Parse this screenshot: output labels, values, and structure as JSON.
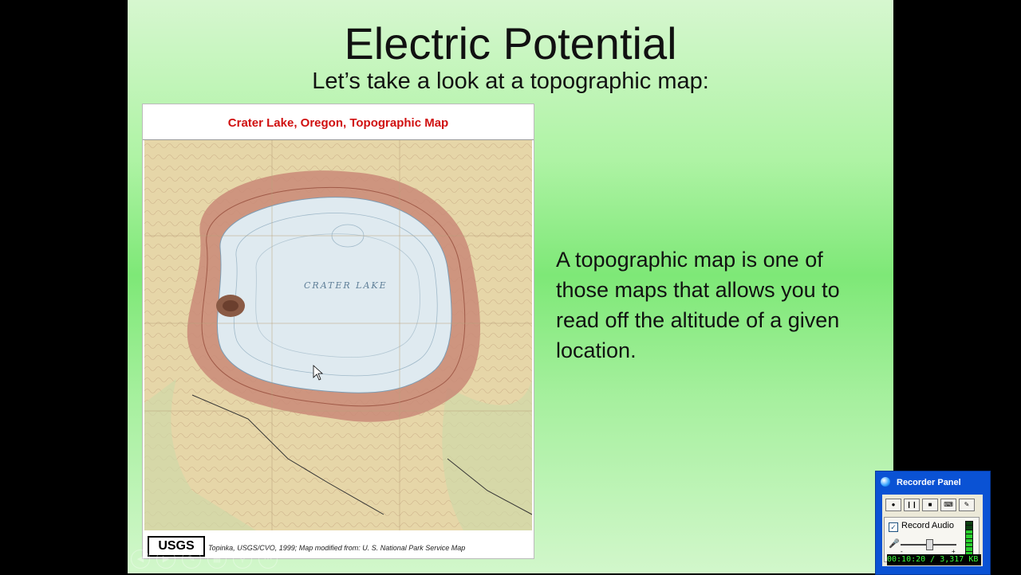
{
  "slide": {
    "title": "Electric Potential",
    "subtitle": "Let’s take a look at a topographic map:",
    "body": "A topographic map is one of those maps that allows you to read off the altitude of a given location."
  },
  "map": {
    "title": "Crater Lake, Oregon, Topographic Map",
    "lake_label": "CRATER LAKE",
    "logo": "USGS",
    "credit": "Topinka, USGS/CVO, 1999; Map modified from: U. S. National Park Service Map",
    "colors": {
      "lake": "#dfeaf0",
      "terrain": "#e6d6a8",
      "rim": "#c98a78",
      "forest": "#cfd9a8"
    }
  },
  "recorder": {
    "title": "Recorder Panel",
    "icon": "globe-icon",
    "buttons": [
      {
        "icon": "record-icon",
        "glyph": "●"
      },
      {
        "icon": "pause-icon",
        "glyph": "❙❙"
      },
      {
        "icon": "stop-icon",
        "glyph": "■"
      },
      {
        "icon": "keyboard-icon",
        "glyph": "⌨"
      },
      {
        "icon": "pen-icon",
        "glyph": "✎"
      }
    ],
    "record_audio_label": "Record Audio",
    "record_audio_checked": true,
    "volume_minus": "-",
    "volume_plus": "+",
    "status": "00:10:20 / 3,317 KB"
  }
}
